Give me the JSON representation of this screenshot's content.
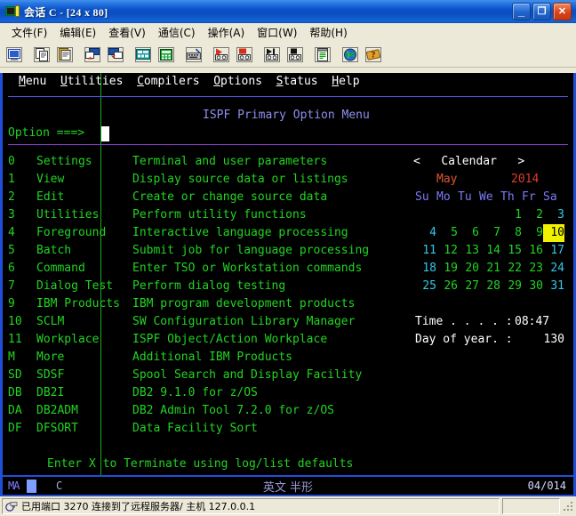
{
  "window": {
    "title": "会话 C - [24 x 80]",
    "icon": "terminal-session-icon",
    "minimize_label": "_",
    "maximize_label": "❐",
    "close_label": "✕"
  },
  "menubar": {
    "items": [
      {
        "label": "文件(F)",
        "accel": "F"
      },
      {
        "label": "编辑(E)",
        "accel": "E"
      },
      {
        "label": "查看(V)",
        "accel": "V"
      },
      {
        "label": "通信(C)",
        "accel": "C"
      },
      {
        "label": "操作(A)",
        "accel": "A"
      },
      {
        "label": "窗口(W)",
        "accel": "W"
      },
      {
        "label": "帮助(H)",
        "accel": "H"
      }
    ]
  },
  "toolbar": {
    "buttons": [
      {
        "name": "display-session-icon",
        "tip": "显示"
      },
      {
        "name": "copy-icon",
        "tip": "复制"
      },
      {
        "name": "paste-icon",
        "tip": "粘贴"
      },
      {
        "name": "send-file-icon",
        "tip": "发送文件"
      },
      {
        "name": "receive-file-icon",
        "tip": "接收文件"
      },
      {
        "name": "keypad-icon",
        "tip": "小键盘"
      },
      {
        "name": "calculator-icon",
        "tip": "计算器"
      },
      {
        "name": "keyboard-setup-icon",
        "tip": "键盘设置"
      },
      {
        "name": "record-macro-icon",
        "tip": "录制宏"
      },
      {
        "name": "stop-macro-icon",
        "tip": "停止录制"
      },
      {
        "name": "play-macro-icon",
        "tip": "播放宏"
      },
      {
        "name": "stop-play-icon",
        "tip": "停止播放"
      },
      {
        "name": "notepad-icon",
        "tip": "记事本"
      },
      {
        "name": "internet-icon",
        "tip": "Internet"
      },
      {
        "name": "help-icon",
        "tip": "帮助"
      }
    ]
  },
  "terminal": {
    "action_bar": [
      {
        "label": "Menu",
        "mnemonic": "M"
      },
      {
        "label": "Utilities",
        "mnemonic": "U"
      },
      {
        "label": "Compilers",
        "mnemonic": "C"
      },
      {
        "label": "Options",
        "mnemonic": "O"
      },
      {
        "label": "Status",
        "mnemonic": "S"
      },
      {
        "label": "Help",
        "mnemonic": "H"
      }
    ],
    "screen_title": "ISPF Primary Option Menu",
    "command_prompt": "Option ===>",
    "command_value": "",
    "options": [
      {
        "code": "0",
        "name": "Settings",
        "desc": "Terminal and user parameters"
      },
      {
        "code": "1",
        "name": "View",
        "desc": "Display source data or listings"
      },
      {
        "code": "2",
        "name": "Edit",
        "desc": "Create or change source data"
      },
      {
        "code": "3",
        "name": "Utilities",
        "desc": "Perform utility functions"
      },
      {
        "code": "4",
        "name": "Foreground",
        "desc": "Interactive language processing"
      },
      {
        "code": "5",
        "name": "Batch",
        "desc": "Submit job for language processing"
      },
      {
        "code": "6",
        "name": "Command",
        "desc": "Enter TSO or Workstation commands"
      },
      {
        "code": "7",
        "name": "Dialog Test",
        "desc": "Perform dialog testing"
      },
      {
        "code": "9",
        "name": "IBM Products",
        "desc": "IBM program development products"
      },
      {
        "code": "10",
        "name": "SCLM",
        "desc": "SW Configuration Library Manager"
      },
      {
        "code": "11",
        "name": "Workplace",
        "desc": "ISPF Object/Action Workplace"
      },
      {
        "code": "M",
        "name": "More",
        "desc": "Additional IBM Products"
      },
      {
        "code": "SD",
        "name": "SDSF",
        "desc": "Spool Search and Display Facility"
      },
      {
        "code": "DB",
        "name": "DB2I",
        "desc": "DB2 9.1.0 for z/OS"
      },
      {
        "code": "DA",
        "name": "DB2ADM",
        "desc": "DB2 Admin Tool 7.2.0 for z/OS"
      },
      {
        "code": "DF",
        "name": "DFSORT",
        "desc": "Data Facility Sort"
      }
    ],
    "footer": "Enter X to Terminate using log/list defaults",
    "calendar": {
      "prev_arrow": "<",
      "next_arrow": ">",
      "heading": "Calendar",
      "month": "May",
      "year": "2014",
      "day_headers": [
        "Su",
        "Mo",
        "Tu",
        "We",
        "Th",
        "Fr",
        "Sa"
      ],
      "weeks": [
        [
          "",
          "",
          "",
          "",
          "1",
          "2",
          "3"
        ],
        [
          "4",
          "5",
          "6",
          "7",
          "8",
          "9",
          "10"
        ],
        [
          "11",
          "12",
          "13",
          "14",
          "15",
          "16",
          "17"
        ],
        [
          "18",
          "19",
          "20",
          "21",
          "22",
          "23",
          "24"
        ],
        [
          "25",
          "26",
          "27",
          "28",
          "29",
          "30",
          "31"
        ]
      ],
      "selected_day": "10"
    },
    "time_label": "Time . . . . :",
    "time_value": "08:47",
    "dayofyear_label": "Day of year. :",
    "dayofyear_value": "130"
  },
  "oia": {
    "connection_indicator": "MA",
    "session_id": "C",
    "ime_status": "英文 半形",
    "cursor_position": "04/014"
  },
  "statusbar": {
    "message": "已用端口 3270 连接到了远程服务器/ 主机 127.0.0.1",
    "secondary": ""
  },
  "colors": {
    "terminal_bg": "#000000",
    "green": "#22d422",
    "blue": "#8f8ff0",
    "white": "#ffffff",
    "cyan": "#31c9e8",
    "red": "#e03c2c",
    "highlight_bg": "#f2f200",
    "title_blue": "#0a52c8"
  }
}
